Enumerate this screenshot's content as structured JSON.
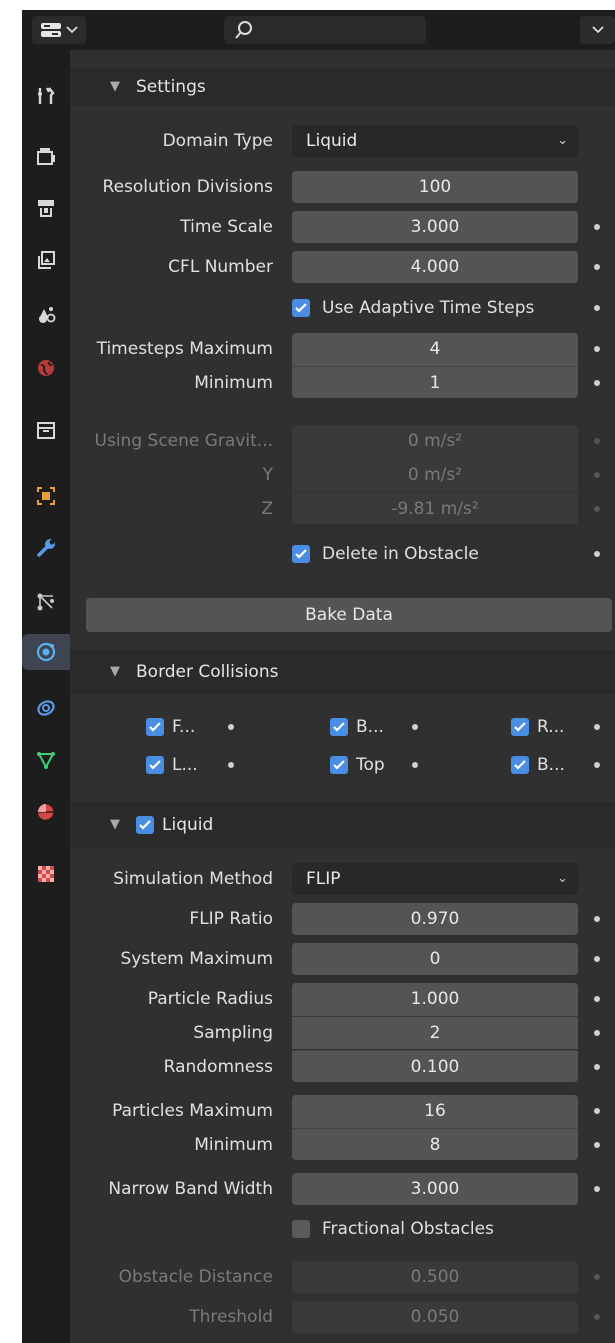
{
  "header": {
    "editor_icon": "properties-editor-icon",
    "search_icon": "search-icon",
    "dropdown_icon": "chevron-down-icon"
  },
  "tabs": [
    {
      "name": "tool-tab",
      "icon": "tool-icon"
    },
    {
      "name": "render-tab",
      "icon": "render-icon"
    },
    {
      "name": "output-tab",
      "icon": "output-icon"
    },
    {
      "name": "view-layer-tab",
      "icon": "view-layer-icon"
    },
    {
      "name": "scene-tab",
      "icon": "scene-icon"
    },
    {
      "name": "world-tab",
      "icon": "world-icon"
    },
    {
      "name": "collection-tab",
      "icon": "collection-icon"
    },
    {
      "name": "object-tab",
      "icon": "object-icon"
    },
    {
      "name": "modifier-tab",
      "icon": "wrench-icon"
    },
    {
      "name": "particles-tab",
      "icon": "particles-icon"
    },
    {
      "name": "physics-tab",
      "icon": "physics-icon",
      "active": true
    },
    {
      "name": "constraints-tab",
      "icon": "constraints-icon"
    },
    {
      "name": "data-tab",
      "icon": "mesh-data-icon"
    },
    {
      "name": "material-tab",
      "icon": "material-icon"
    },
    {
      "name": "texture-tab",
      "icon": "texture-icon"
    }
  ],
  "settings": {
    "title": "Settings",
    "domain_type_label": "Domain Type",
    "domain_type_value": "Liquid",
    "resolution_label": "Resolution Divisions",
    "resolution_value": "100",
    "time_scale_label": "Time Scale",
    "time_scale_value": "3.000",
    "cfl_label": "CFL Number",
    "cfl_value": "4.000",
    "adaptive_label": "Use Adaptive Time Steps",
    "adaptive_checked": true,
    "timesteps_max_label": "Timesteps Maximum",
    "timesteps_max_value": "4",
    "timesteps_min_label": "Minimum",
    "timesteps_min_value": "1",
    "gravity_label": "Using Scene Gravit...",
    "gravity_x": "0 m/s²",
    "gravity_y_label": "Y",
    "gravity_y": "0 m/s²",
    "gravity_z_label": "Z",
    "gravity_z": "-9.81 m/s²",
    "delete_obstacle_label": "Delete in Obstacle",
    "delete_obstacle_checked": true,
    "bake_label": "Bake Data"
  },
  "border_collisions": {
    "title": "Border Collisions",
    "items": [
      {
        "label": "F...",
        "checked": true
      },
      {
        "label": "B...",
        "checked": true
      },
      {
        "label": "R...",
        "checked": true
      },
      {
        "label": "L...",
        "checked": true
      },
      {
        "label": "Top",
        "checked": true
      },
      {
        "label": "B...",
        "checked": true
      }
    ]
  },
  "liquid": {
    "title": "Liquid",
    "enabled": true,
    "sim_method_label": "Simulation Method",
    "sim_method_value": "FLIP",
    "flip_ratio_label": "FLIP Ratio",
    "flip_ratio_value": "0.970",
    "system_max_label": "System Maximum",
    "system_max_value": "0",
    "particle_radius_label": "Particle Radius",
    "particle_radius_value": "1.000",
    "sampling_label": "Sampling",
    "sampling_value": "2",
    "randomness_label": "Randomness",
    "randomness_value": "0.100",
    "particles_max_label": "Particles Maximum",
    "particles_max_value": "16",
    "particles_min_label": "Minimum",
    "particles_min_value": "8",
    "narrow_band_label": "Narrow Band Width",
    "narrow_band_value": "3.000",
    "fractional_label": "Fractional Obstacles",
    "fractional_checked": false,
    "obstacle_dist_label": "Obstacle Distance",
    "obstacle_dist_value": "0.500",
    "threshold_label": "Threshold",
    "threshold_value": "0.050"
  },
  "colors": {
    "panel_bg": "#303030",
    "field_bg": "#545454",
    "accent_blue": "#4a8ee4",
    "header_bg": "#1d1d1d"
  }
}
